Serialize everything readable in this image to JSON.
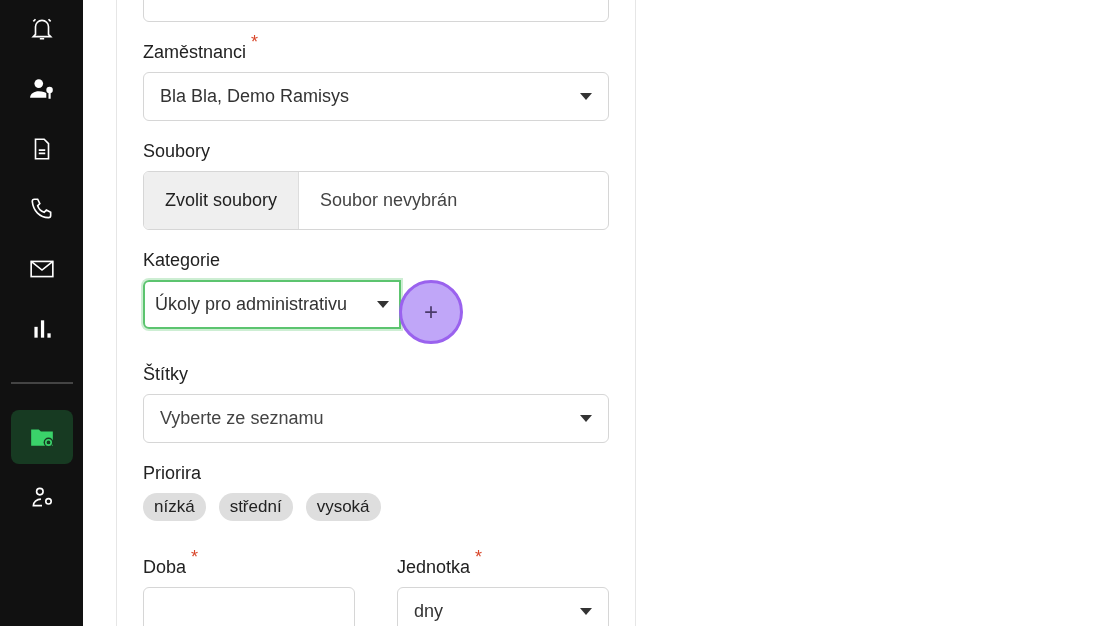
{
  "sidebar": {
    "items": [
      {
        "selected": false
      },
      {
        "selected": false
      },
      {
        "selected": false
      },
      {
        "selected": false
      },
      {
        "selected": false
      },
      {
        "selected": false
      },
      {
        "selected": true
      },
      {
        "selected": false
      }
    ]
  },
  "form": {
    "description": {
      "kind": "textarea"
    },
    "employees": {
      "label": "Zaměstnanci",
      "required_mark": "*",
      "value": "Bla Bla, Demo Ramisys"
    },
    "files": {
      "label": "Soubory",
      "button": "Zvolit soubory",
      "status": "Soubor nevybrán"
    },
    "category": {
      "label": "Kategorie",
      "value": "Úkoly pro administrativu",
      "focused": true,
      "add_button": {
        "label": "+",
        "highlighted": true
      }
    },
    "tags": {
      "label": "Štítky",
      "placeholder": "Vyberte ze seznamu"
    },
    "priority": {
      "label": "Priorira",
      "options": [
        {
          "label": "nízká",
          "selected": false
        },
        {
          "label": "střední",
          "selected": false
        },
        {
          "label": "vysoká",
          "selected": false
        }
      ]
    },
    "duration": {
      "label": "Doba",
      "required_mark": "*"
    },
    "unit": {
      "label": "Jednotka",
      "required_mark": "*",
      "value": "dny"
    }
  }
}
